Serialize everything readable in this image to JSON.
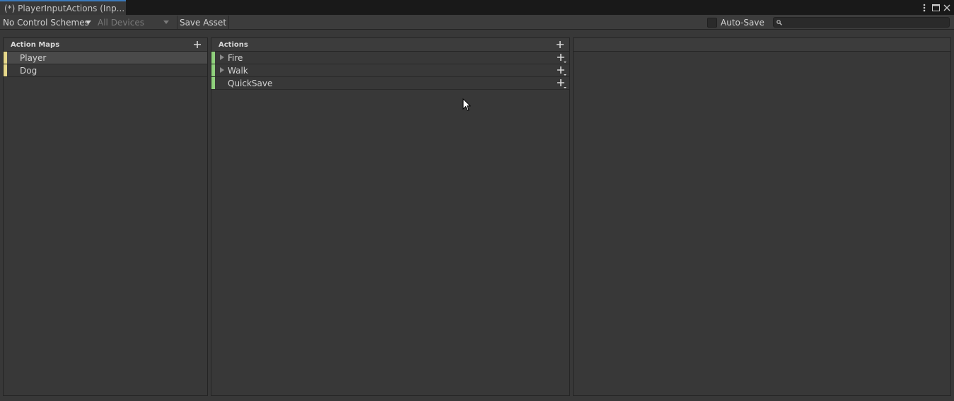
{
  "window": {
    "tab_title": "(*) PlayerInputActions (Inp...",
    "icons": [
      "more-vert-icon",
      "maximize-icon",
      "close-icon"
    ]
  },
  "toolbar": {
    "control_schemes": "No Control Schemes",
    "devices": "All Devices",
    "save_label": "Save Asset",
    "autosave_label": "Auto-Save",
    "autosave_checked": false,
    "search_value": ""
  },
  "action_maps": {
    "header": "Action Maps",
    "items": [
      {
        "label": "Player",
        "selected": true
      },
      {
        "label": "Dog",
        "selected": false
      }
    ]
  },
  "actions": {
    "header": "Actions",
    "items": [
      {
        "label": "Fire",
        "has_children": true
      },
      {
        "label": "Walk",
        "has_children": true
      },
      {
        "label": "QuickSave",
        "has_children": false
      }
    ]
  },
  "colors": {
    "map_bar": "#e6d88a",
    "action_bar": "#8fd07c",
    "tab_accent": "#3a79bb"
  }
}
